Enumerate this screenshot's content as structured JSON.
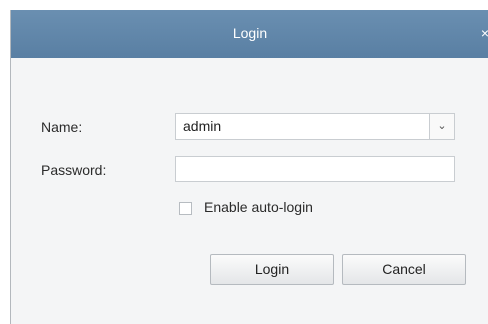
{
  "dialog": {
    "title": "Login",
    "close_glyph": "×"
  },
  "form": {
    "name_label": "Name:",
    "name_value": "admin",
    "password_label": "Password:",
    "password_value": "",
    "auto_login_label": "Enable auto-login",
    "auto_login_checked": false
  },
  "buttons": {
    "login": "Login",
    "cancel": "Cancel"
  },
  "icons": {
    "dropdown": "chevron-down-icon",
    "close": "close-icon"
  },
  "colors": {
    "titlebar": "#6387ab",
    "window_bg": "#f4f5f6"
  }
}
